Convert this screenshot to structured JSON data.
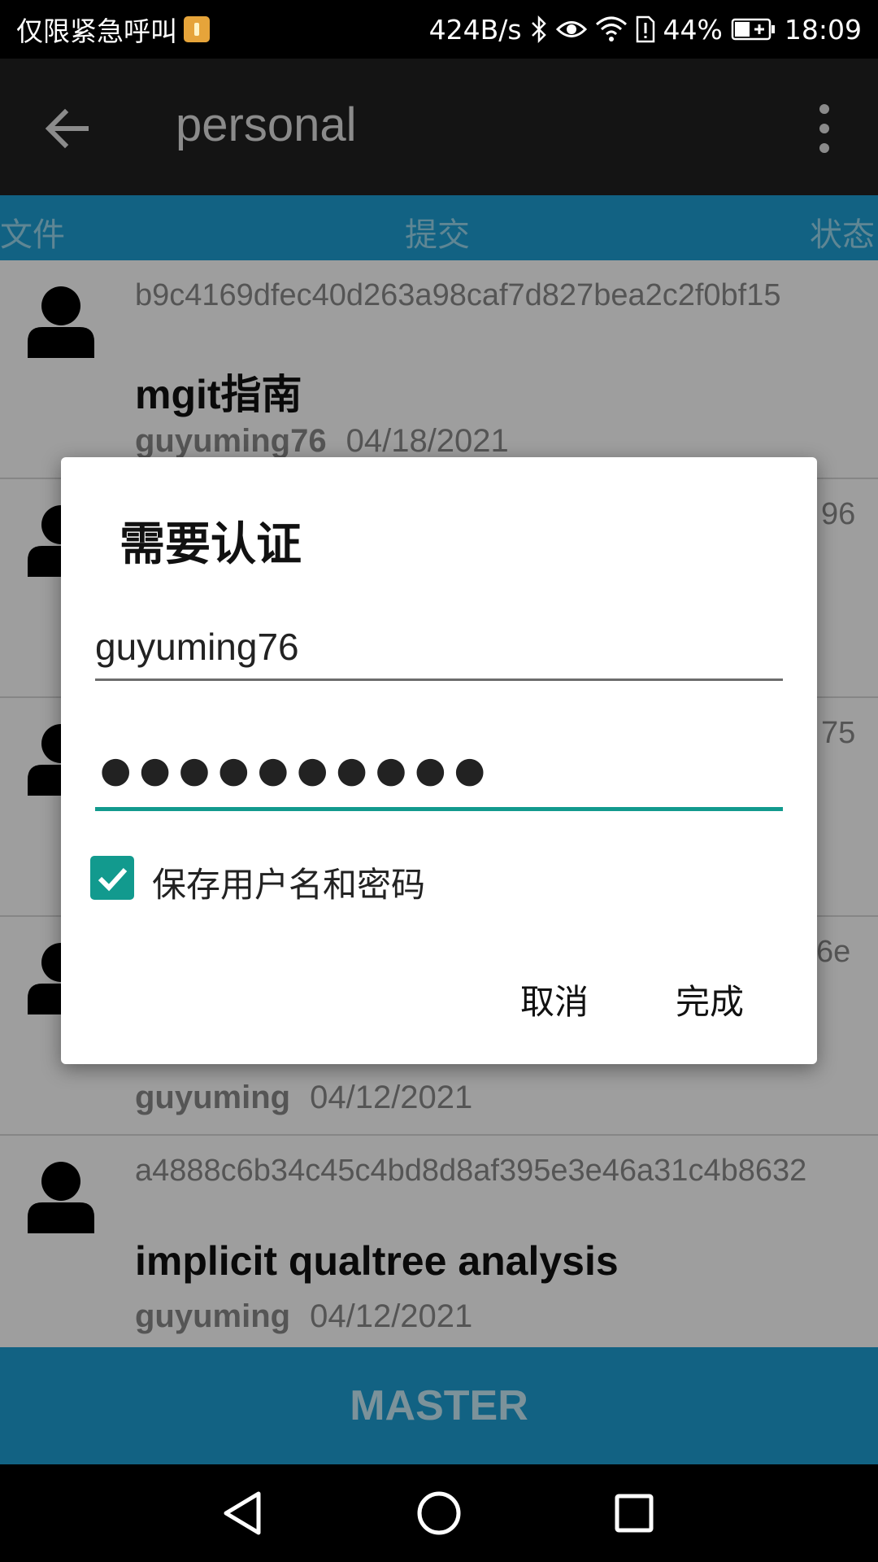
{
  "status_bar": {
    "carrier": "仅限紧急呼叫",
    "net_speed": "424B/s",
    "battery": "44%",
    "time": "18:09"
  },
  "toolbar": {
    "title": "personal"
  },
  "tabs": [
    {
      "label": "文件"
    },
    {
      "label": "提交"
    },
    {
      "label": "状态"
    }
  ],
  "commits": [
    {
      "sha": "b9c4169dfec40d263a98caf7d827bea2c2f0bf15",
      "message": "mgit指南",
      "author": "guyuming76",
      "date": "04/18/2021"
    },
    {
      "sha_tail": "96"
    },
    {
      "sha_tail": "75"
    },
    {
      "sha_tail": "6e",
      "author": "guyuming",
      "date": "04/12/2021"
    },
    {
      "sha": "a4888c6b34c45c4bd8d8af395e3e46a31c4b8632",
      "message": "implicit qualtree analysis",
      "author": "guyuming",
      "date": "04/12/2021"
    }
  ],
  "branch": "MASTER",
  "dialog": {
    "title": "需要认证",
    "username": "guyuming76",
    "password_mask": "●●●●●●●●●●",
    "save_label": "保存用户名和密码",
    "save_checked": true,
    "cancel_label": "取消",
    "done_label": "完成"
  },
  "colors": {
    "toolbar": "#212121",
    "accent_blue": "#1e9fd3",
    "teal": "#129a8e"
  }
}
